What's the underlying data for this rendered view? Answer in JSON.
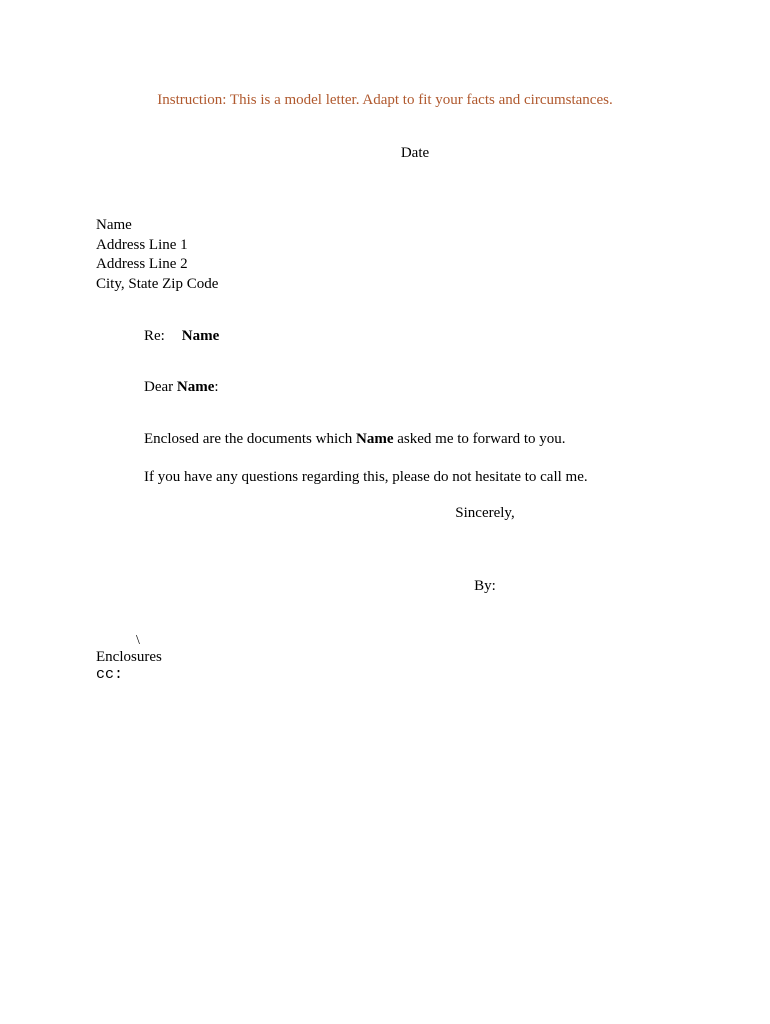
{
  "instruction": "Instruction:  This is a model letter.  Adapt to fit your facts and circumstances.",
  "date_label": "Date",
  "address": {
    "name": "Name",
    "line1": "Address Line 1",
    "line2": "Address Line 2",
    "city_state_zip": "City, State  Zip Code"
  },
  "re": {
    "label": "Re:",
    "value": "Name"
  },
  "salutation": {
    "prefix": "Dear ",
    "name": "Name",
    "suffix": ":"
  },
  "body": {
    "para1_part1": "Enclosed are the documents which ",
    "para1_name": "Name",
    "para1_part2": " asked me to forward to you.",
    "para2": "If you have any questions regarding this, please do not hesitate to call me."
  },
  "closing": "Sincerely,",
  "by_label": "By:",
  "backslash": "\\",
  "enclosures": "Enclosures",
  "cc": "cc:"
}
